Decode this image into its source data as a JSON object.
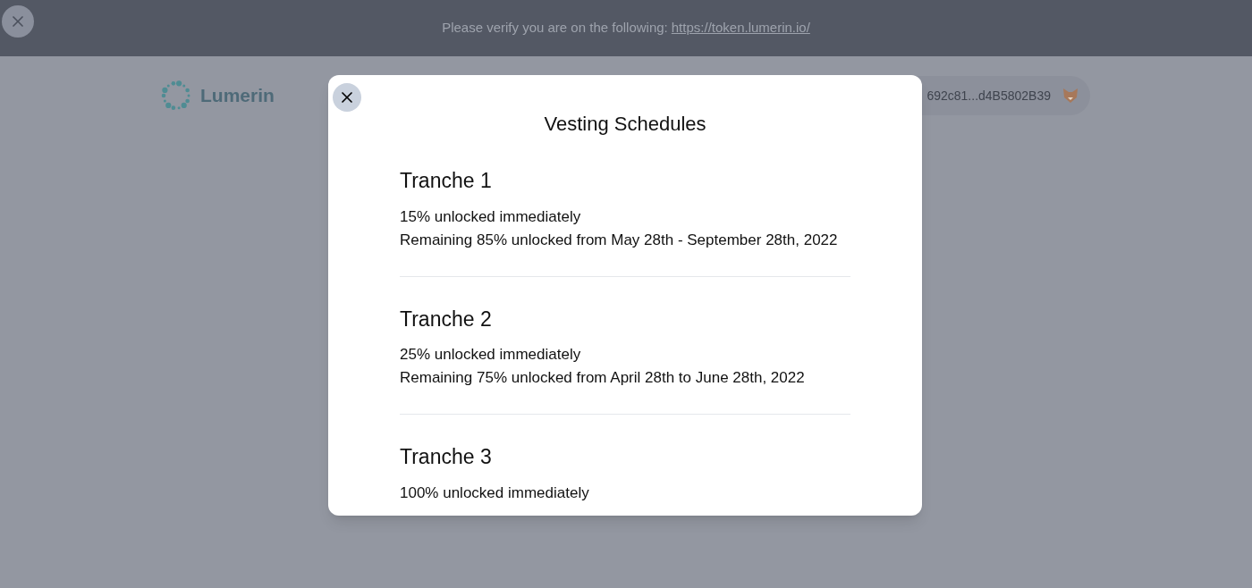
{
  "banner": {
    "message": "Please verify you are on the following:",
    "link": "https://token.lumerin.io/"
  },
  "header": {
    "logo": "Lumerin",
    "wallet": "692c81...d4B5802B39"
  },
  "modal": {
    "title": "Vesting Schedules",
    "tranches": [
      {
        "name": "Tranche 1",
        "lines": [
          "15% unlocked immediately",
          "Remaining 85% unlocked from May 28th - September 28th, 2022"
        ]
      },
      {
        "name": "Tranche 2",
        "lines": [
          "25% unlocked immediately",
          "Remaining 75% unlocked from April 28th to June 28th, 2022"
        ]
      },
      {
        "name": "Tranche 3",
        "lines": [
          "100% unlocked immediately"
        ]
      }
    ]
  }
}
